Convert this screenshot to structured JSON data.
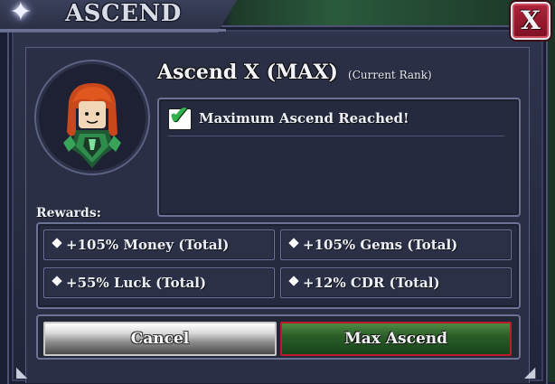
{
  "window": {
    "title": "ASCEND",
    "close_label": "X"
  },
  "rank": {
    "name": "Ascend X (MAX)",
    "subtitle": "(Current Rank)"
  },
  "status": {
    "checked": true,
    "message": "Maximum Ascend Reached!"
  },
  "rewards": {
    "label": "Rewards:",
    "items": [
      {
        "text": "+105% Money (Total)"
      },
      {
        "text": "+105% Gems (Total)"
      },
      {
        "text": "+55% Luck (Total)"
      },
      {
        "text": "+12% CDR (Total)"
      }
    ]
  },
  "actions": {
    "cancel_label": "Cancel",
    "confirm_label": "Max Ascend"
  },
  "colors": {
    "panel": "#2a2f45",
    "border": "#6b7294",
    "close_red": "#b0233a",
    "confirm_green": "#2b5e28",
    "confirm_border": "#c1192c",
    "check_green": "#2fb34a"
  },
  "icons": {
    "title": "sparkle-star-icon",
    "close": "close-x-icon",
    "status": "checkmark-icon",
    "reward_bullet": "diamond-bullet-icon"
  }
}
